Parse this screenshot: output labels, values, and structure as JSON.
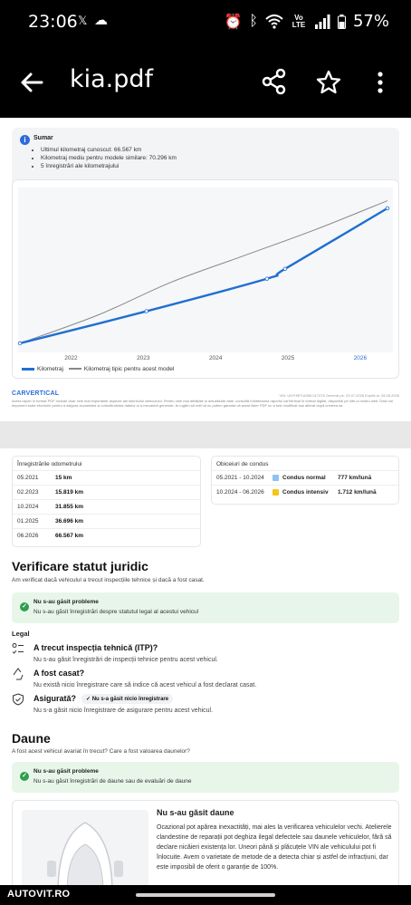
{
  "status_bar": {
    "time": "23:06",
    "battery": "57%",
    "network": "Vo LTE"
  },
  "app_bar": {
    "title": "kia.pdf"
  },
  "summary": {
    "title": "Sumar",
    "items": [
      "Ultimul kilometraj cunoscut: 66.567 km",
      "Kilometraj mediu pentru modele similare: 70.296 km",
      "5 înregistrări ale kilometrajului"
    ]
  },
  "chart_data": {
    "type": "line",
    "x_ticks": [
      "2022",
      "2023",
      "2024",
      "2025",
      "2026"
    ],
    "series": [
      {
        "name": "Kilometraj",
        "color": "#1f6fd1",
        "style": "dashed-thick",
        "points": [
          [
            "2021-05",
            15
          ],
          [
            "2023-02",
            15819
          ],
          [
            "2024-10",
            31855
          ],
          [
            "2025-01",
            36696
          ],
          [
            "2026-06",
            66567
          ]
        ]
      },
      {
        "name": "Kilometraj tipic pentru acest model",
        "color": "#888888",
        "style": "solid-thin",
        "points": [
          [
            "2021-05",
            0
          ],
          [
            "2022-06",
            14000
          ],
          [
            "2023-06",
            30000
          ],
          [
            "2024-06",
            43000
          ],
          [
            "2025-06",
            56000
          ],
          [
            "2026-06",
            70296
          ]
        ]
      }
    ],
    "ylim": [
      0,
      75000
    ],
    "grid": false,
    "legend_position": "bottom-left"
  },
  "doc_footer": {
    "brand": "CARVERTICAL",
    "meta": "VIN: U5YH5F1A0ML017478     Generat pe: 29.07.2026     Expiră la: 28.08.2026",
    "fine_print": "Acest raport în format PDF include doar cele mai importante aspecte ale istoricului vehiculului. Pentru cele mai detaliate și actualizate date, consultă întotdeauna raportul carVertical în format digital, disponibil pe site-ul nostru web. Deși noi depunem toate eforturile pentru a asigura acuratețea și corectitudinea datelor și a mecanicii generale, te rugăm să reții că nu putem garanta că acest fișier PDF nu a fost modificat sau alterat după crearea sa."
  },
  "odometer": {
    "title": "Înregistrările odometrului",
    "rows": [
      {
        "date": "05.2021",
        "km": "15 km"
      },
      {
        "date": "02.2023",
        "km": "15.819 km"
      },
      {
        "date": "10.2024",
        "km": "31.855 km"
      },
      {
        "date": "01.2025",
        "km": "36.696 km"
      },
      {
        "date": "06.2026",
        "km": "66.567 km"
      }
    ]
  },
  "driving": {
    "title": "Obiceiuri de condus",
    "rows": [
      {
        "period": "05.2021 - 10.2024",
        "style": "Condus normal",
        "color": "#8fc3ef",
        "rate": "777 km/lună"
      },
      {
        "period": "10.2024 - 06.2026",
        "style": "Condus intensiv",
        "color": "#f5c518",
        "rate": "1.712 km/lună"
      }
    ]
  },
  "legal": {
    "title": "Verificare statut juridic",
    "subtitle": "Am verificat dacă vehiculul a trecut inspecțiile tehnice și dacă a fost casat.",
    "ok_title": "Nu s-au găsit probleme",
    "ok_text": "Nu s-au găsit înregistrări despre statutul legal al acestui vehicul",
    "label": "Legal",
    "items": [
      {
        "heading": "A trecut inspecția tehnică (ITP)?",
        "body": "Nu s-au găsit înregistrări de inspecții tehnice pentru acest vehicul."
      },
      {
        "heading": "A fost casat?",
        "body": "Nu există nicio înregistrare care să indice că acest vehicul a fost declarat casat."
      },
      {
        "heading": "Asigurată?",
        "pill": "Nu s-a găsit nicio înregistrare",
        "body": "Nu s-a găsit nicio înregistrare de asigurare pentru acest vehicul."
      }
    ]
  },
  "damage": {
    "title": "Daune",
    "subtitle": "A fost acest vehicul avariat în trecut? Care a fost valoarea daunelor?",
    "ok_title": "Nu s-au găsit probleme",
    "ok_text": "Nu s-au găsit înregistrări de daune sau de evaluări de daune",
    "card_title": "Nu s-au găsit daune",
    "card_text": "Ocazional pot apărea inexactități, mai ales la verificarea vehiculelor vechi. Atelierele clandestine de reparații pot deghiza ilegal defectele sau daunele vehiculelor, fără să declare nicăieri existența lor. Uneori până și plăcuțele VIN ale vehiculului pot fi înlocuite. Avem o varietate de metode de a detecta chiar și astfel de infracțiuni, dar este imposibil de oferit o garanție de 100%."
  },
  "ad": {
    "logo": "AUTOVIT.RO"
  }
}
